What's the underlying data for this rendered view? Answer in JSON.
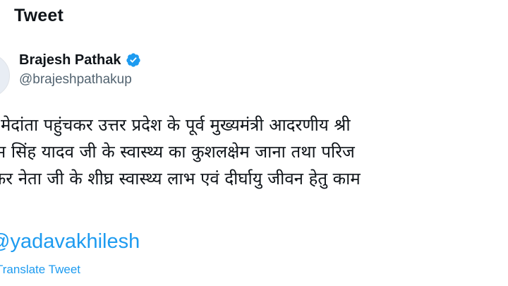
{
  "header": {
    "title": "Tweet"
  },
  "author": {
    "name": "Brajesh Pathak",
    "handle": "@brajeshpathakup",
    "verified_icon": "verified-badge-icon",
    "verified_color": "#1d9bf0"
  },
  "tweet": {
    "lines": [
      "ने मेदांता पहुंचकर उत्तर प्रदेश के पूर्व मुख्यमंत्री आदरणीय श्री",
      "यम सिंह यादव जी के स्वास्थ्य का कुशलक्षेम जाना तथा परिज",
      "रकर नेता जी के शीघ्र स्वास्थ्य लाभ एवं दीर्घायु जीवन हेतु काम"
    ],
    "hashtag": "@yadavakhilesh",
    "translate_label": "Translate Tweet"
  },
  "colors": {
    "link": "#1d9bf0",
    "text": "#0f1419",
    "secondary": "#536471"
  }
}
